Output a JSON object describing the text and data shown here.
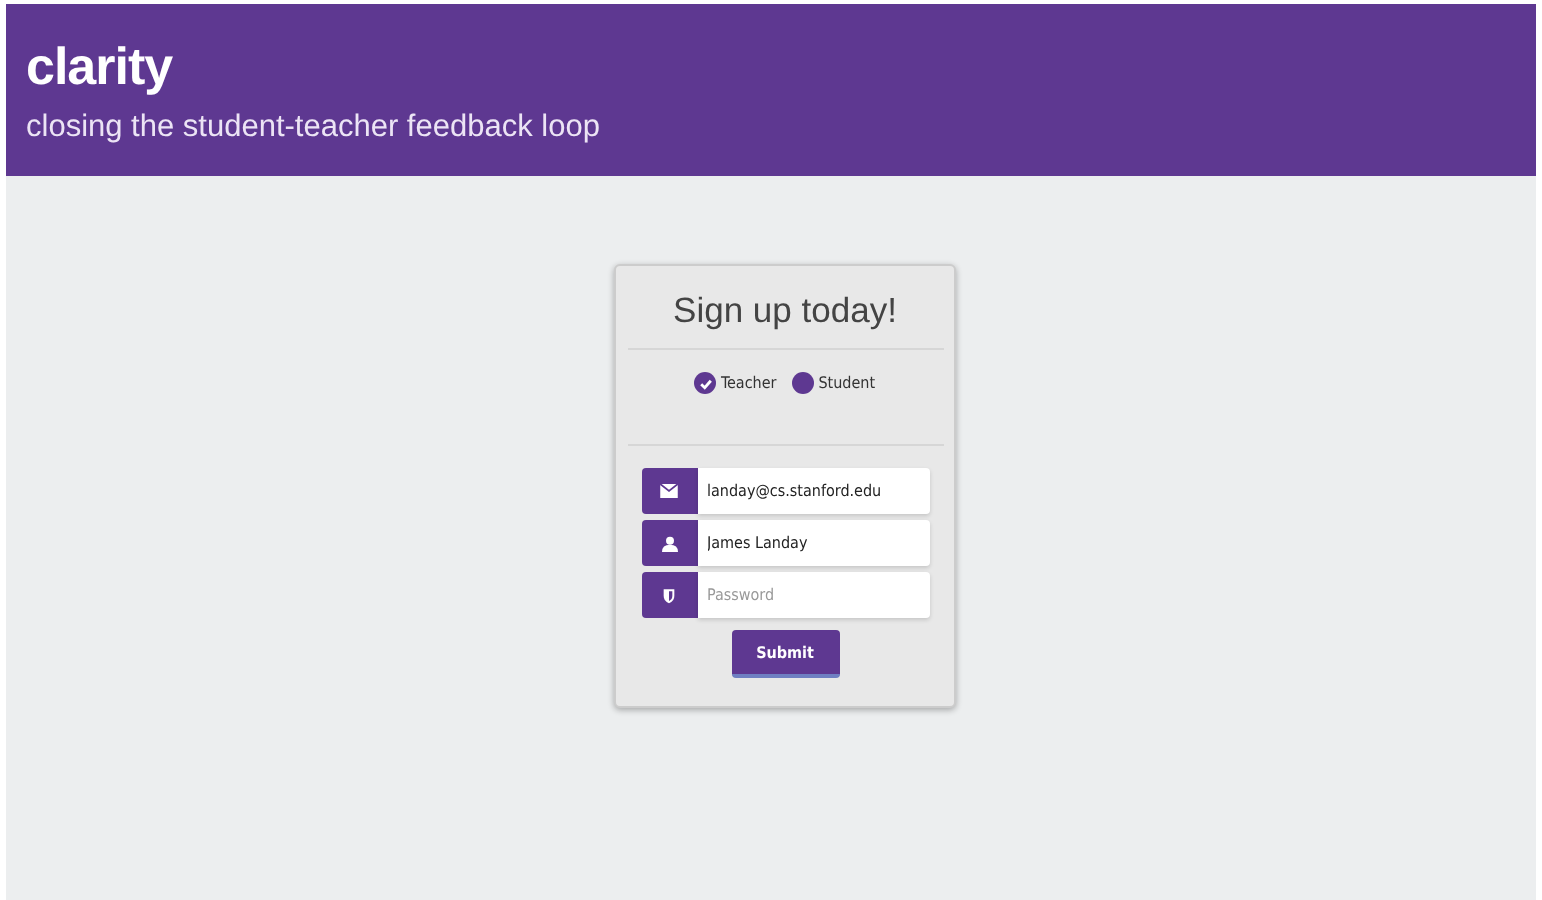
{
  "header": {
    "title": "clarity",
    "tagline": "closing the student-teacher feedback loop"
  },
  "form": {
    "title": "Sign up today!",
    "roles": [
      {
        "label": "Teacher",
        "selected": true
      },
      {
        "label": "Student",
        "selected": false
      }
    ],
    "fields": [
      {
        "kind": "email",
        "value": "landay@cs.stanford.edu"
      },
      {
        "kind": "user",
        "value": "James Landay"
      },
      {
        "kind": "password",
        "placeholder": "Password"
      }
    ],
    "submit": "Submit"
  }
}
